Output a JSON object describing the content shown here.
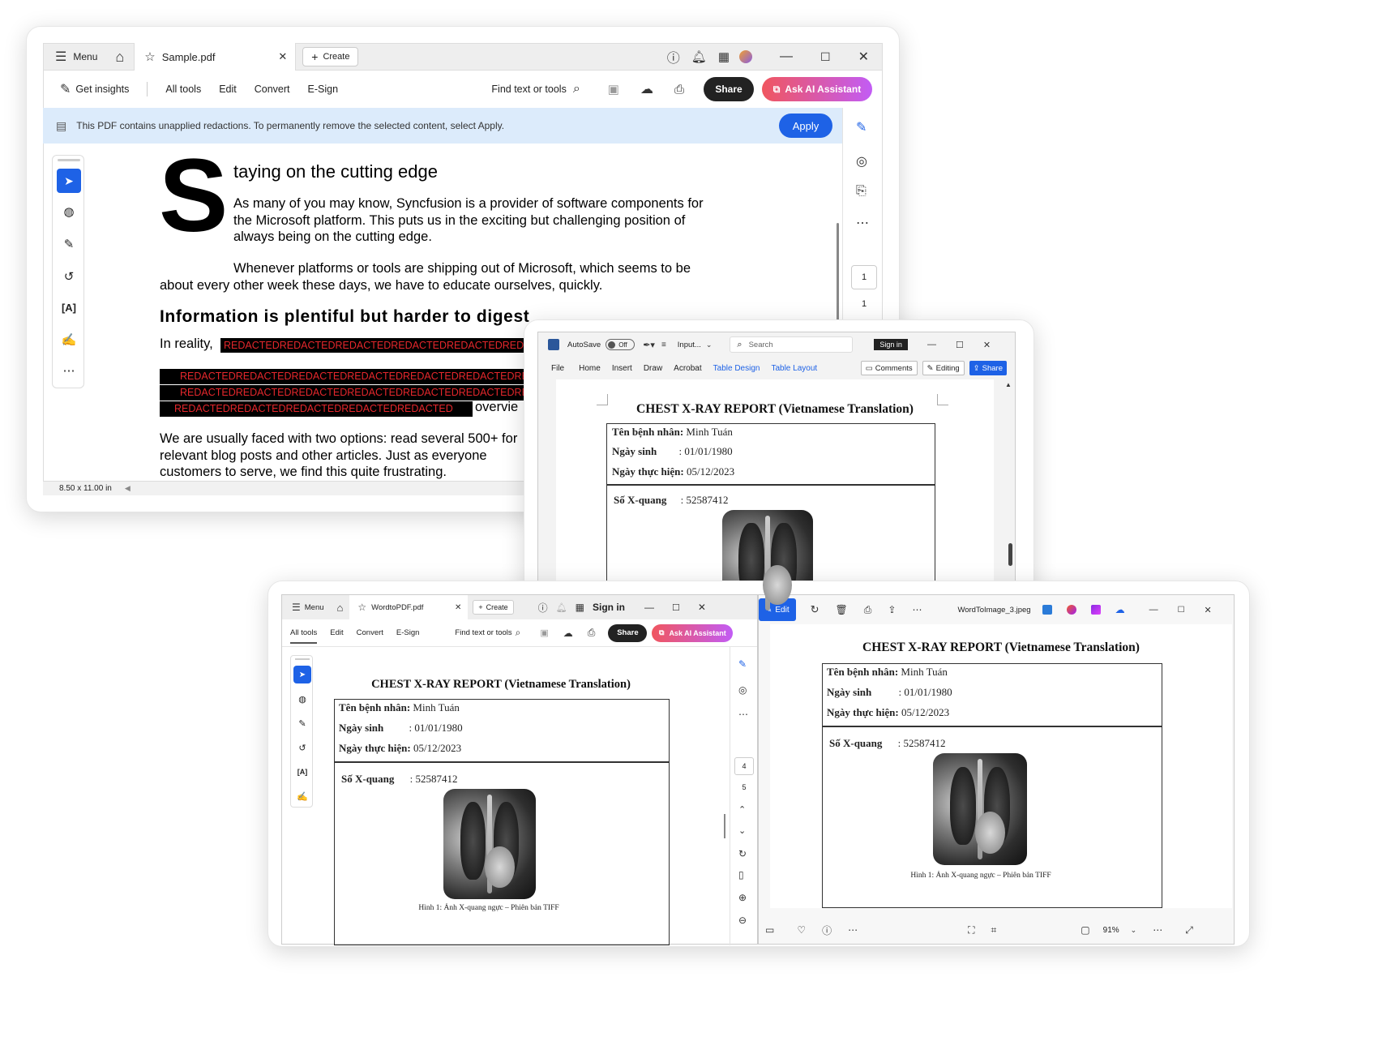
{
  "window1": {
    "menu_label": "Menu",
    "tab_title": "Sample.pdf",
    "create_label": "Create",
    "get_insights": "Get insights",
    "nav": [
      "All tools",
      "Edit",
      "Convert",
      "E-Sign"
    ],
    "find_label": "Find text or tools",
    "share_label": "Share",
    "ai_label": "Ask AI Assistant",
    "banner_text": "This PDF contains unapplied redactions. To permanently remove the selected content, select Apply.",
    "apply_label": "Apply",
    "dropcap": "S",
    "heading1": "taying on the cutting edge",
    "para1": "As many of you may know, Syncfusion is a provider of software components for the Microsoft platform. This puts us in the exciting but challenging position of always being on the cutting edge.",
    "para2": "Whenever platforms or tools are shipping out of Microsoft, which seems to be about every other week these days, we have to educate ourselves, quickly.",
    "heading2": "Information is plentiful but harder to digest",
    "reality": "In reality,",
    "redact_text": "REDACTEDREDACTEDREDACTEDREDACTEDREDACTEDREDACTEDREDACTED",
    "redact_short": "REDACTEDREDACTEDREDACTEDREDACTEDREDACTED",
    "overview": "overvie",
    "para3": "We are usually faced with two options: read several 500+ for relevant blog posts and other articles. Just as everyone customers to serve, we find this quite frustrating.",
    "page_size": "8.50 x 11.00 in",
    "page_num_box": "1",
    "page_num": "1"
  },
  "window2": {
    "autosave": "AutoSave",
    "toggle": "Off",
    "input_label": "Input...",
    "search_label": "Search",
    "signin": "Sign in",
    "ribbon": [
      "File",
      "Home",
      "Insert",
      "Draw",
      "Acrobat",
      "Table Design",
      "Table Layout"
    ],
    "comments": "Comments",
    "editing": "Editing",
    "share": "Share"
  },
  "window3": {
    "menu_label": "Menu",
    "tab_title": "WordtoPDF.pdf",
    "create_label": "Create",
    "signin": "Sign in",
    "nav": [
      "All tools",
      "Edit",
      "Convert",
      "E-Sign"
    ],
    "find_label": "Find text or tools",
    "share_label": "Share",
    "ai_label": "Ask AI Assistant",
    "page_box": "4",
    "page_total": "5",
    "edit_label": "Edit",
    "file_name": "WordToImage_3.jpeg",
    "zoom": "91%"
  },
  "report": {
    "title": "CHEST X-RAY REPORT (Vietnamese Translation)",
    "patient_label": "Tên bệnh nhân:",
    "patient_value": "Minh Tuán",
    "dob_label": "Ngày sinh",
    "dob_value": ": 01/01/1980",
    "date_label": "Ngày thực hiện:",
    "date_value": "05/12/2023",
    "xray_label": "Số X-quang",
    "xray_value": ": 52587412",
    "caption": "Hình 1: Ảnh X-quang ngực – Phiên bản TIFF"
  },
  "colors": {
    "accent": "#1e62e6",
    "banner": "#dcebfb",
    "redact": "#e5272c"
  }
}
